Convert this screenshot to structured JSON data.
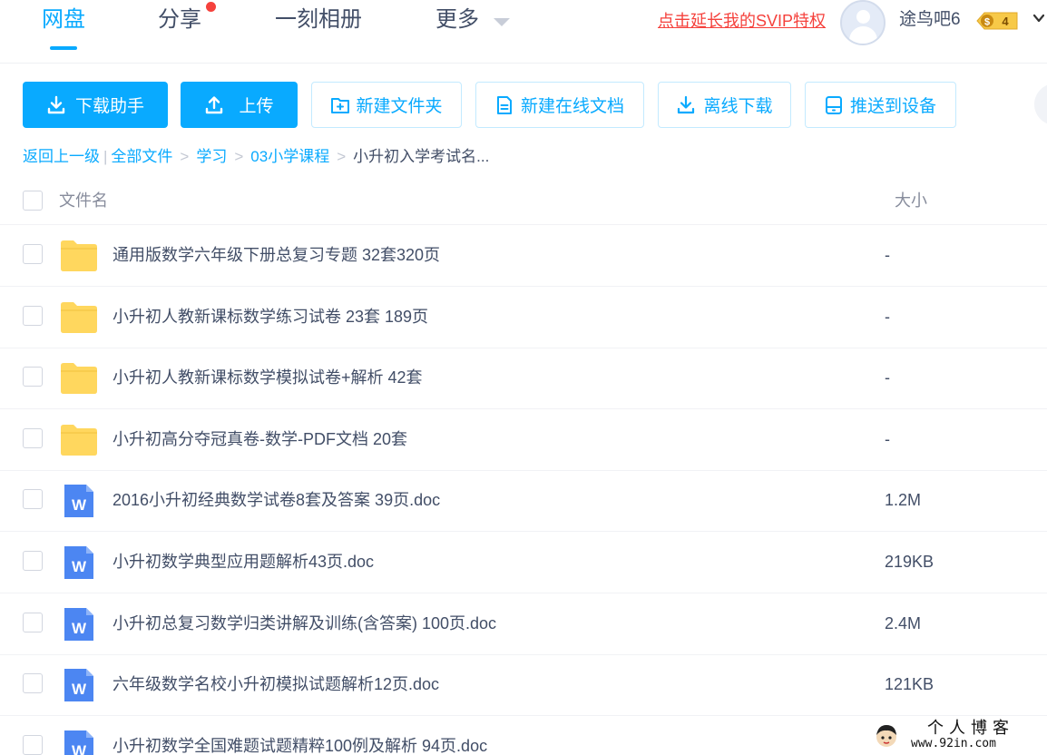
{
  "nav": {
    "tabs": [
      {
        "label": "网盘",
        "active": true
      },
      {
        "label": "分享",
        "has_dot": true
      },
      {
        "label": "一刻相册"
      },
      {
        "label": "更多"
      }
    ]
  },
  "user": {
    "svip_link": "点击延长我的SVIP特权",
    "name": "途鸟吧6",
    "vip_level": "4"
  },
  "toolbar": {
    "download_helper": "下载助手",
    "upload": "上传",
    "new_folder": "新建文件夹",
    "new_online_doc": "新建在线文档",
    "offline_download": "离线下载",
    "push_to_device": "推送到设备"
  },
  "breadcrumb": {
    "back": "返回上一级",
    "items": [
      "全部文件",
      "学习",
      "03小学课程"
    ],
    "current": "小升初入学考试名..."
  },
  "table": {
    "col_name": "文件名",
    "col_size": "大小",
    "rows": [
      {
        "type": "folder",
        "name": "通用版数学六年级下册总复习专题 32套320页",
        "size": "-"
      },
      {
        "type": "folder",
        "name": "小升初人教新课标数学练习试卷 23套 189页",
        "size": "-"
      },
      {
        "type": "folder",
        "name": "小升初人教新课标数学模拟试卷+解析 42套",
        "size": "-"
      },
      {
        "type": "folder",
        "name": "小升初高分夺冠真卷-数学-PDF文档 20套",
        "size": "-"
      },
      {
        "type": "doc",
        "name": "2016小升初经典数学试卷8套及答案 39页.doc",
        "size": "1.2M"
      },
      {
        "type": "doc",
        "name": "小升初数学典型应用题解析43页.doc",
        "size": "219KB"
      },
      {
        "type": "doc",
        "name": "小升初总复习数学归类讲解及训练(含答案) 100页.doc",
        "size": "2.4M"
      },
      {
        "type": "doc",
        "name": "六年级数学名校小升初模拟试题解析12页.doc",
        "size": "121KB"
      },
      {
        "type": "doc",
        "name": "小升初数学全国难题试题精粹100例及解析 94页.doc",
        "size": ""
      }
    ]
  },
  "watermark": {
    "title": "个人博客",
    "url": "www.92in.com"
  },
  "colors": {
    "accent": "#09aaff",
    "text": "#424e67",
    "muted": "#878c9c",
    "svip": "#f5413c",
    "folder": "#ffd75e",
    "doc": "#4c86f2"
  }
}
